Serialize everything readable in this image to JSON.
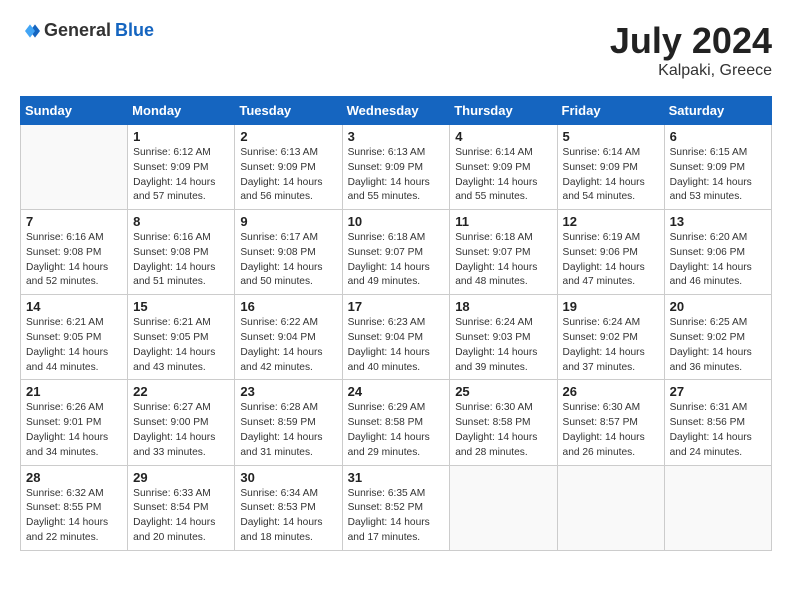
{
  "header": {
    "logo_general": "General",
    "logo_blue": "Blue",
    "title": "July 2024",
    "location": "Kalpaki, Greece"
  },
  "weekdays": [
    "Sunday",
    "Monday",
    "Tuesday",
    "Wednesday",
    "Thursday",
    "Friday",
    "Saturday"
  ],
  "weeks": [
    [
      {
        "day": null
      },
      {
        "day": "1",
        "sunrise": "6:12 AM",
        "sunset": "9:09 PM",
        "daylight": "14 hours and 57 minutes."
      },
      {
        "day": "2",
        "sunrise": "6:13 AM",
        "sunset": "9:09 PM",
        "daylight": "14 hours and 56 minutes."
      },
      {
        "day": "3",
        "sunrise": "6:13 AM",
        "sunset": "9:09 PM",
        "daylight": "14 hours and 55 minutes."
      },
      {
        "day": "4",
        "sunrise": "6:14 AM",
        "sunset": "9:09 PM",
        "daylight": "14 hours and 55 minutes."
      },
      {
        "day": "5",
        "sunrise": "6:14 AM",
        "sunset": "9:09 PM",
        "daylight": "14 hours and 54 minutes."
      },
      {
        "day": "6",
        "sunrise": "6:15 AM",
        "sunset": "9:09 PM",
        "daylight": "14 hours and 53 minutes."
      }
    ],
    [
      {
        "day": "7",
        "sunrise": "6:16 AM",
        "sunset": "9:08 PM",
        "daylight": "14 hours and 52 minutes."
      },
      {
        "day": "8",
        "sunrise": "6:16 AM",
        "sunset": "9:08 PM",
        "daylight": "14 hours and 51 minutes."
      },
      {
        "day": "9",
        "sunrise": "6:17 AM",
        "sunset": "9:08 PM",
        "daylight": "14 hours and 50 minutes."
      },
      {
        "day": "10",
        "sunrise": "6:18 AM",
        "sunset": "9:07 PM",
        "daylight": "14 hours and 49 minutes."
      },
      {
        "day": "11",
        "sunrise": "6:18 AM",
        "sunset": "9:07 PM",
        "daylight": "14 hours and 48 minutes."
      },
      {
        "day": "12",
        "sunrise": "6:19 AM",
        "sunset": "9:06 PM",
        "daylight": "14 hours and 47 minutes."
      },
      {
        "day": "13",
        "sunrise": "6:20 AM",
        "sunset": "9:06 PM",
        "daylight": "14 hours and 46 minutes."
      }
    ],
    [
      {
        "day": "14",
        "sunrise": "6:21 AM",
        "sunset": "9:05 PM",
        "daylight": "14 hours and 44 minutes."
      },
      {
        "day": "15",
        "sunrise": "6:21 AM",
        "sunset": "9:05 PM",
        "daylight": "14 hours and 43 minutes."
      },
      {
        "day": "16",
        "sunrise": "6:22 AM",
        "sunset": "9:04 PM",
        "daylight": "14 hours and 42 minutes."
      },
      {
        "day": "17",
        "sunrise": "6:23 AM",
        "sunset": "9:04 PM",
        "daylight": "14 hours and 40 minutes."
      },
      {
        "day": "18",
        "sunrise": "6:24 AM",
        "sunset": "9:03 PM",
        "daylight": "14 hours and 39 minutes."
      },
      {
        "day": "19",
        "sunrise": "6:24 AM",
        "sunset": "9:02 PM",
        "daylight": "14 hours and 37 minutes."
      },
      {
        "day": "20",
        "sunrise": "6:25 AM",
        "sunset": "9:02 PM",
        "daylight": "14 hours and 36 minutes."
      }
    ],
    [
      {
        "day": "21",
        "sunrise": "6:26 AM",
        "sunset": "9:01 PM",
        "daylight": "14 hours and 34 minutes."
      },
      {
        "day": "22",
        "sunrise": "6:27 AM",
        "sunset": "9:00 PM",
        "daylight": "14 hours and 33 minutes."
      },
      {
        "day": "23",
        "sunrise": "6:28 AM",
        "sunset": "8:59 PM",
        "daylight": "14 hours and 31 minutes."
      },
      {
        "day": "24",
        "sunrise": "6:29 AM",
        "sunset": "8:58 PM",
        "daylight": "14 hours and 29 minutes."
      },
      {
        "day": "25",
        "sunrise": "6:30 AM",
        "sunset": "8:58 PM",
        "daylight": "14 hours and 28 minutes."
      },
      {
        "day": "26",
        "sunrise": "6:30 AM",
        "sunset": "8:57 PM",
        "daylight": "14 hours and 26 minutes."
      },
      {
        "day": "27",
        "sunrise": "6:31 AM",
        "sunset": "8:56 PM",
        "daylight": "14 hours and 24 minutes."
      }
    ],
    [
      {
        "day": "28",
        "sunrise": "6:32 AM",
        "sunset": "8:55 PM",
        "daylight": "14 hours and 22 minutes."
      },
      {
        "day": "29",
        "sunrise": "6:33 AM",
        "sunset": "8:54 PM",
        "daylight": "14 hours and 20 minutes."
      },
      {
        "day": "30",
        "sunrise": "6:34 AM",
        "sunset": "8:53 PM",
        "daylight": "14 hours and 18 minutes."
      },
      {
        "day": "31",
        "sunrise": "6:35 AM",
        "sunset": "8:52 PM",
        "daylight": "14 hours and 17 minutes."
      },
      {
        "day": null
      },
      {
        "day": null
      },
      {
        "day": null
      }
    ]
  ]
}
